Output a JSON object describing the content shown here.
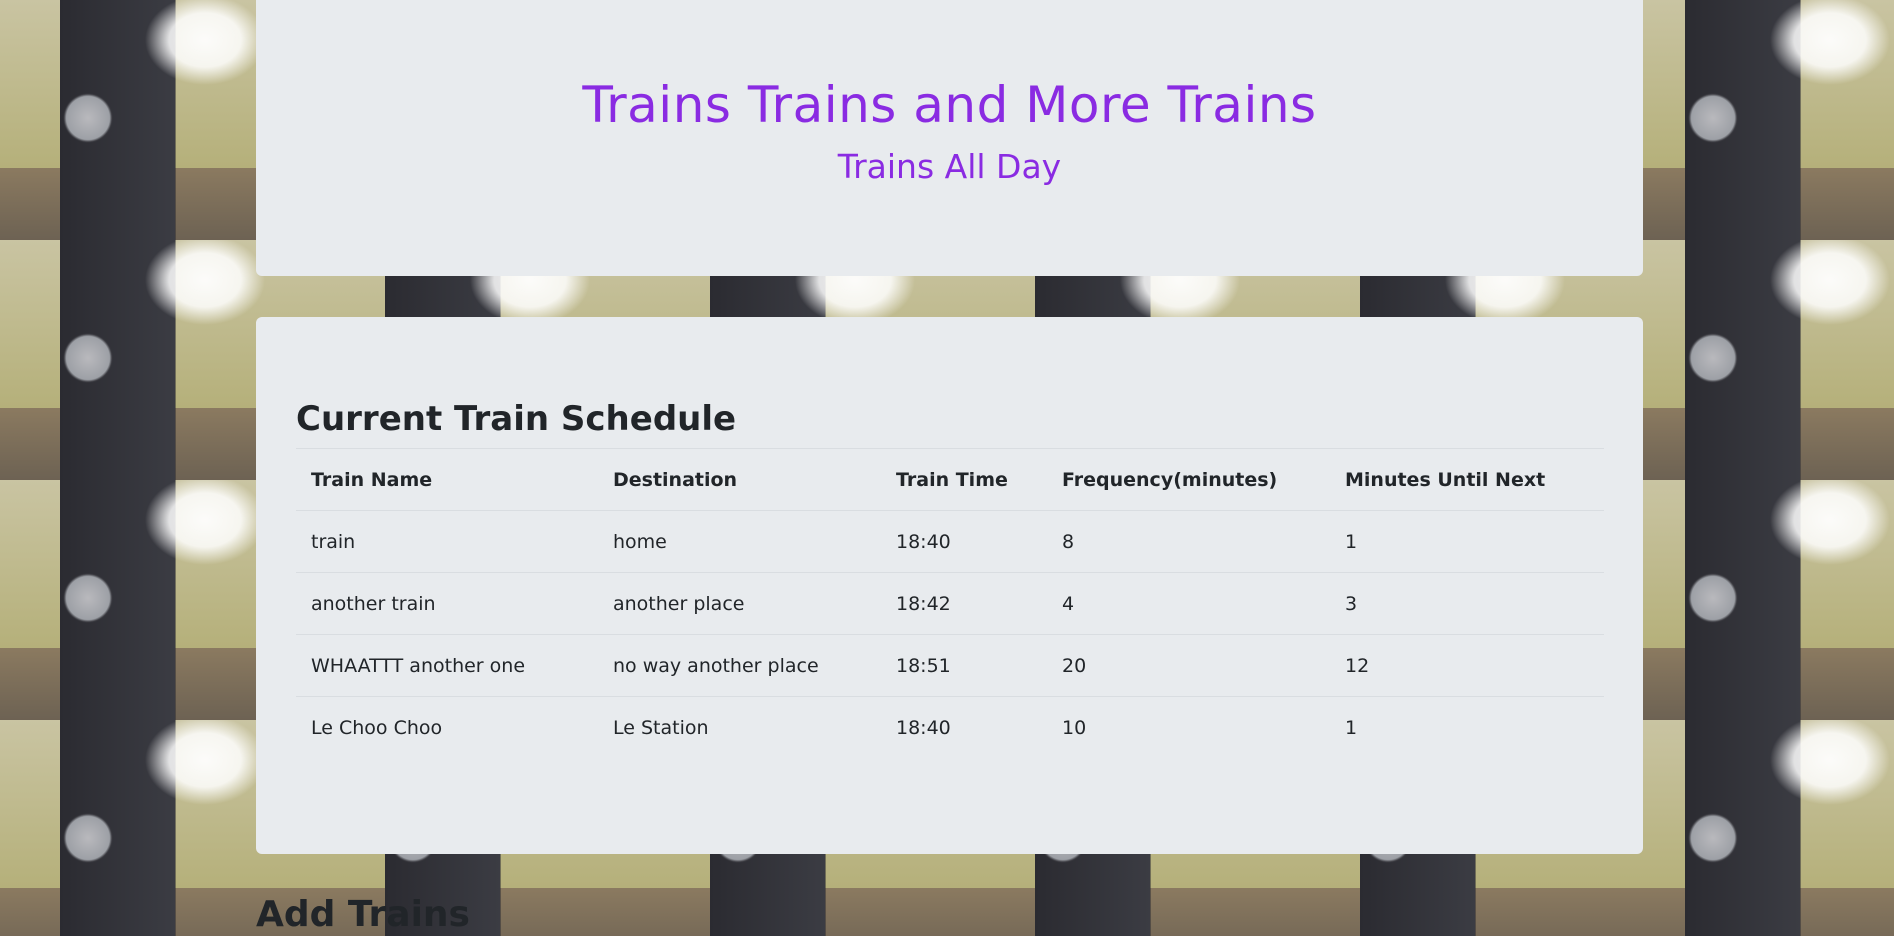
{
  "header": {
    "title": "Trains Trains and More Trains",
    "subtitle": "Trains All Day"
  },
  "schedule": {
    "heading": "Current Train Schedule",
    "columns": [
      "Train Name",
      "Destination",
      "Train Time",
      "Frequency(minutes)",
      "Minutes Until Next"
    ],
    "rows": [
      [
        "train",
        "home",
        "18:40",
        "8",
        "1"
      ],
      [
        "another train",
        "another place",
        "18:42",
        "4",
        "3"
      ],
      [
        "WHAATTT another one",
        "no way another place",
        "18:51",
        "20",
        "12"
      ],
      [
        "Le Choo Choo",
        "Le Station",
        "18:40",
        "10",
        "1"
      ]
    ]
  },
  "add_section": {
    "heading": "Add Trains"
  },
  "colors": {
    "accent": "#8a2be2",
    "panel": "#e8ebee",
    "text": "#212529"
  }
}
